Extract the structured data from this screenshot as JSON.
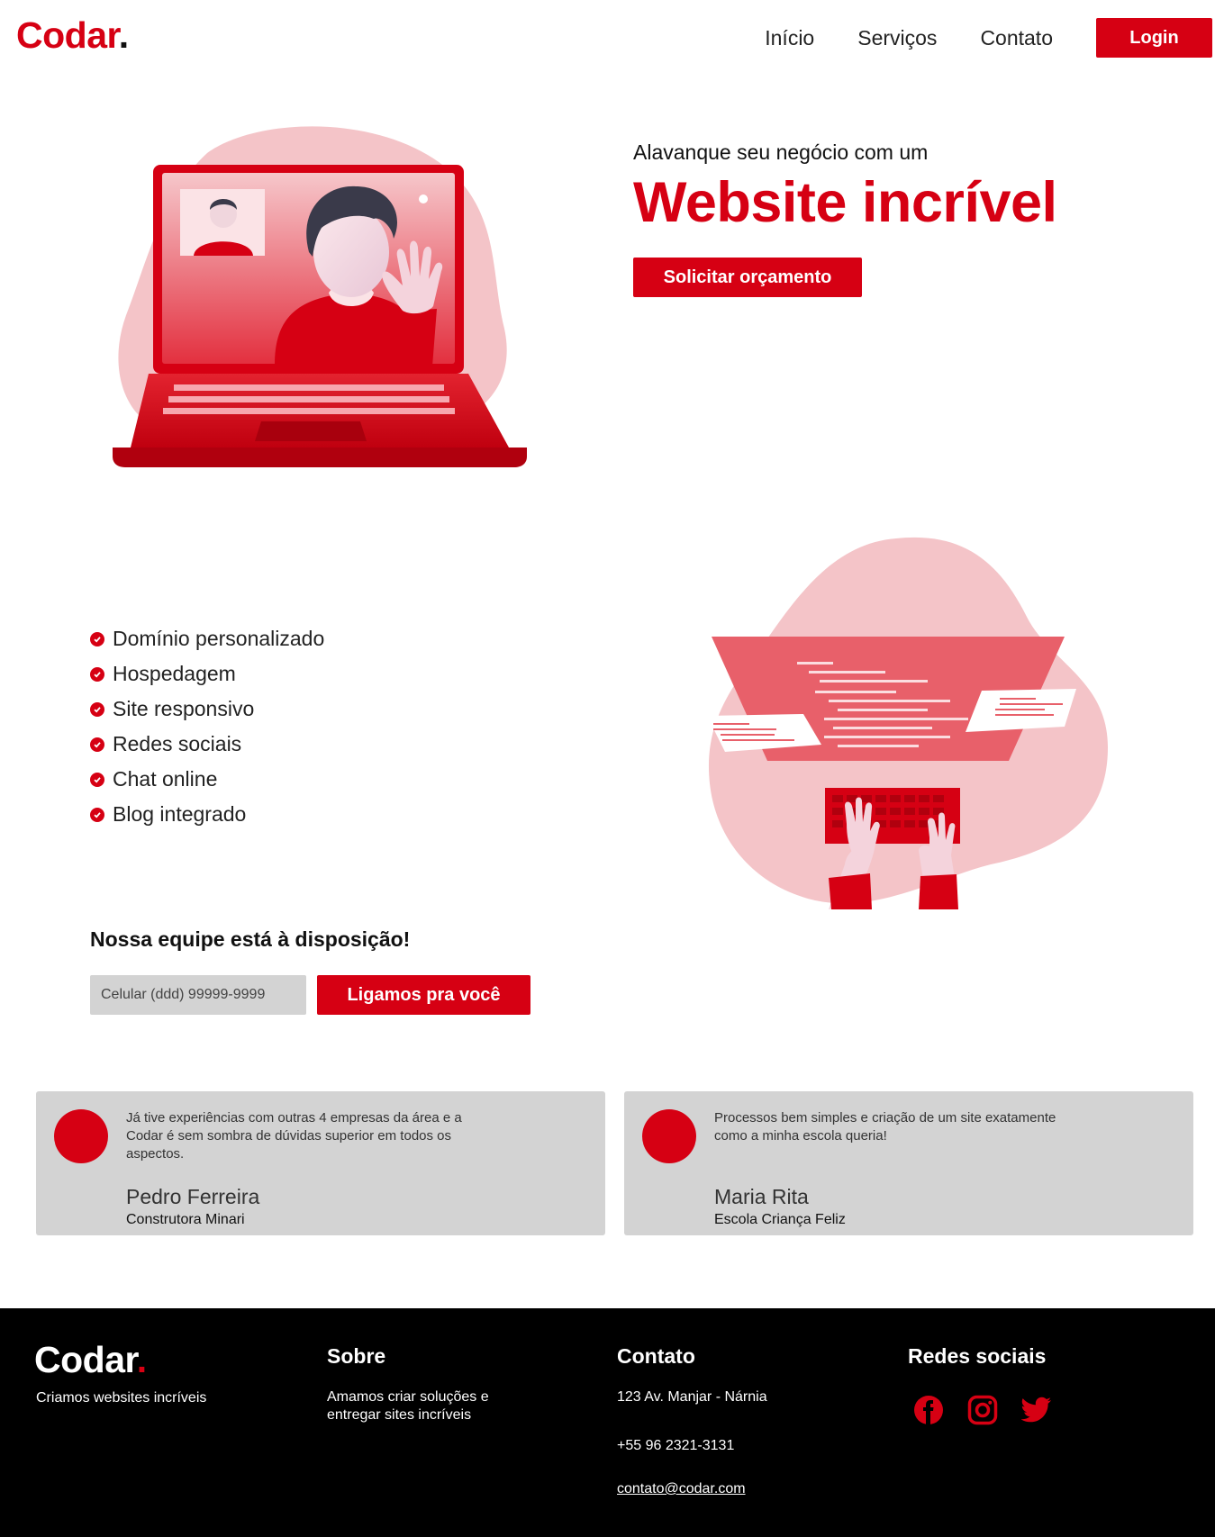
{
  "header": {
    "logo_text": "Codar",
    "logo_dot": ".",
    "nav": [
      "Início",
      "Serviços",
      "Contato"
    ],
    "login_label": "Login"
  },
  "hero": {
    "pre_title": "Alavanque seu negócio com um",
    "title": "Website incrível",
    "cta_label": "Solicitar orçamento"
  },
  "features": [
    "Domínio personalizado",
    "Hospedagem",
    "Site responsivo",
    "Redes sociais",
    "Chat online",
    "Blog integrado"
  ],
  "contact_form": {
    "title": "Nossa equipe está à disposição!",
    "phone_placeholder": "Celular (ddd) 99999-9999",
    "submit_label": "Ligamos pra você"
  },
  "testimonials": [
    {
      "quote": "Já tive experiências com outras 4 empresas da área e a Codar é sem sombra de dúvidas superior em todos os aspectos.",
      "name": "Pedro Ferreira",
      "company": "Construtora Minari"
    },
    {
      "quote": "Processos bem simples e criação de um site exatamente como a minha escola queria!",
      "name": "Maria Rita",
      "company": "Escola Criança Feliz"
    }
  ],
  "footer": {
    "logo_text": "Codar",
    "logo_dot": ".",
    "tagline": "Criamos websites incríveis",
    "about_title": "Sobre",
    "about_text": "Amamos criar soluções e entregar sites incríveis",
    "contact_title": "Contato",
    "address": "123 Av. Manjar - Nárnia",
    "phone": "+55 96 2321-3131",
    "email": "contato@codar.com",
    "social_title": "Redes sociais",
    "social_icons": [
      "facebook-icon",
      "instagram-icon",
      "twitter-icon"
    ]
  },
  "colors": {
    "brand": "#d60013",
    "light_pink": "#f4c4c8",
    "gray": "#d3d3d3",
    "footer_bg": "#000000"
  }
}
